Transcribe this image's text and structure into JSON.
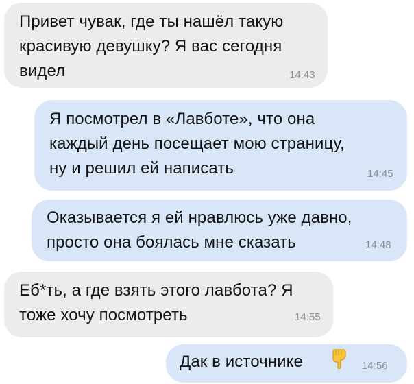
{
  "messages": [
    {
      "direction": "incoming",
      "text": "Привет чувак, где ты нашёл такую\nкрасивую девушку? Я вас сегодня\nвидел",
      "time": "14:43"
    },
    {
      "direction": "outgoing",
      "text": "Я посмотрел в «Лавботе», что она\nкаждый день посещает мою страницу,\nну и решил ей написать",
      "time": "14:45"
    },
    {
      "direction": "outgoing",
      "text": "Оказывается я ей нравлюсь уже давно,\nпросто она боялась мне сказать",
      "time": "14:48"
    },
    {
      "direction": "incoming",
      "text": "Еб*ть, а где взять этого лавбота? Я\nтоже хочу посмотреть",
      "time": "14:55"
    },
    {
      "direction": "outgoing",
      "text": "Дак в источнике",
      "emoji": "backhand-index-pointing-down-icon",
      "time": "14:56"
    }
  ],
  "colors": {
    "incoming_bubble": "#ececec",
    "outgoing_bubble": "#d8e6f8",
    "text": "#141414",
    "time": "#8e8e93"
  }
}
